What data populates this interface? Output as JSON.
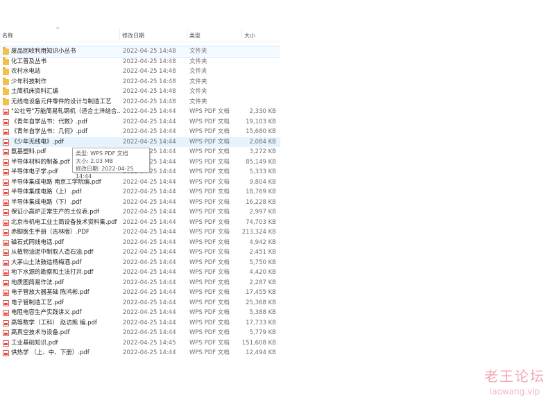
{
  "header": {
    "name": "名称",
    "date": "修改日期",
    "type": "类型",
    "size": "大小",
    "sort_arrow": "^"
  },
  "rows": [
    {
      "name": "废品回收利用知识小丛书",
      "date": "2022-04-25 14:48",
      "type": "文件夹",
      "size": "",
      "kind": "folder"
    },
    {
      "name": "化工普及丛书",
      "date": "2022-04-25 14:48",
      "type": "文件夹",
      "size": "",
      "kind": "folder"
    },
    {
      "name": "农村水电站",
      "date": "2022-04-25 14:48",
      "type": "文件夹",
      "size": "",
      "kind": "folder"
    },
    {
      "name": "少年科技制作",
      "date": "2022-04-25 14:48",
      "type": "文件夹",
      "size": "",
      "kind": "folder"
    },
    {
      "name": "土简机床资料汇编",
      "date": "2022-04-25 14:48",
      "type": "文件夹",
      "size": "",
      "kind": "folder"
    },
    {
      "name": "无线电设备元件零件的设计与制造工艺",
      "date": "2022-04-25 14:48",
      "type": "文件夹",
      "size": "",
      "kind": "folder"
    },
    {
      "name": "\"公社号\"万能简易轧钢机（适合土洋结合...",
      "date": "2022-04-25 14:44",
      "type": "WPS PDF 文档",
      "size": "2,330 KB",
      "kind": "pdf"
    },
    {
      "name": "《青年自学丛书：代数》.pdf",
      "date": "2022-04-25 14:44",
      "type": "WPS PDF 文档",
      "size": "19,103 KB",
      "kind": "pdf"
    },
    {
      "name": "《青年自学丛书：几何》.pdf",
      "date": "2022-04-25 14:44",
      "type": "WPS PDF 文档",
      "size": "15,680 KB",
      "kind": "pdf"
    },
    {
      "name": "《少年无线电》.pdf",
      "date": "2022-04-25 14:44",
      "type": "WPS PDF 文档",
      "size": "2,084 KB",
      "kind": "pdf"
    },
    {
      "name": "氨基塑料.pdf",
      "date": "2022-04-25 14:44",
      "type": "WPS PDF 文档",
      "size": "3,272 KB",
      "kind": "pdf"
    },
    {
      "name": "半导体材料的制备.pdf",
      "date": "2022-04-25 14:44",
      "type": "WPS PDF 文档",
      "size": "85,149 KB",
      "kind": "pdf"
    },
    {
      "name": "半导体电子学.pdf",
      "date": "2022-04-25 14:44",
      "type": "WPS PDF 文档",
      "size": "5,333 KB",
      "kind": "pdf"
    },
    {
      "name": "半导体集成电路 南京工学院编.pdf",
      "date": "2022-04-25 14:44",
      "type": "WPS PDF 文档",
      "size": "9,804 KB",
      "kind": "pdf"
    },
    {
      "name": "半导体集成电路（上）.pdf",
      "date": "2022-04-25 14:44",
      "type": "WPS PDF 文档",
      "size": "18,769 KB",
      "kind": "pdf"
    },
    {
      "name": "半导体集成电路（下）.pdf",
      "date": "2022-04-25 14:44",
      "type": "WPS PDF 文档",
      "size": "16,228 KB",
      "kind": "pdf"
    },
    {
      "name": "保证小高炉正常生产的土仪表.pdf",
      "date": "2022-04-25 14:44",
      "type": "WPS PDF 文档",
      "size": "2,997 KB",
      "kind": "pdf"
    },
    {
      "name": "北京市机电工业土简设备技术资料集.pdf",
      "date": "2022-04-25 14:44",
      "type": "WPS PDF 文档",
      "size": "74,703 KB",
      "kind": "pdf"
    },
    {
      "name": "赤脚医生手册（吉林版）.PDF",
      "date": "2022-04-25 14:44",
      "type": "WPS PDF 文档",
      "size": "213,324 KB",
      "kind": "pdf"
    },
    {
      "name": "磁石式同线电话.pdf",
      "date": "2022-04-25 14:44",
      "type": "WPS PDF 文档",
      "size": "4,942 KB",
      "kind": "pdf"
    },
    {
      "name": "从植物油泥中制取人造石油.pdf",
      "date": "2022-04-25 14:44",
      "type": "WPS PDF 文档",
      "size": "2,451 KB",
      "kind": "pdf"
    },
    {
      "name": "大茅山土法鼓造杨梅酒.pdf",
      "date": "2022-04-25 14:44",
      "type": "WPS PDF 文档",
      "size": "5,750 KB",
      "kind": "pdf"
    },
    {
      "name": "地下水源的勘察和土法打井.pdf",
      "date": "2022-04-25 14:44",
      "type": "WPS PDF 文档",
      "size": "4,420 KB",
      "kind": "pdf"
    },
    {
      "name": "地质图简易作法.pdf",
      "date": "2022-04-25 14:44",
      "type": "WPS PDF 文档",
      "size": "2,287 KB",
      "kind": "pdf"
    },
    {
      "name": "电子管放大器基础 陈鸿彬.pdf",
      "date": "2022-04-25 14:44",
      "type": "WPS PDF 文档",
      "size": "17,455 KB",
      "kind": "pdf"
    },
    {
      "name": "电子管制造工艺.pdf",
      "date": "2022-04-25 14:44",
      "type": "WPS PDF 文档",
      "size": "25,368 KB",
      "kind": "pdf"
    },
    {
      "name": "电阻电容生产实践讲义.pdf",
      "date": "2022-04-25 14:44",
      "type": "WPS PDF 文档",
      "size": "5,388 KB",
      "kind": "pdf"
    },
    {
      "name": "高等数学（工科） 赵访熊 编.pdf",
      "date": "2022-04-25 14:44",
      "type": "WPS PDF 文档",
      "size": "17,733 KB",
      "kind": "pdf"
    },
    {
      "name": "高真空技术与设备.pdf",
      "date": "2022-04-25 14:44",
      "type": "WPS PDF 文档",
      "size": "5,779 KB",
      "kind": "pdf"
    },
    {
      "name": "工业基础知识.pdf",
      "date": "2022-04-25 14:45",
      "type": "WPS PDF 文档",
      "size": "151,608 KB",
      "kind": "pdf"
    },
    {
      "name": "供热学 （上、中、下册）.pdf",
      "date": "2022-04-25 14:44",
      "type": "WPS PDF 文档",
      "size": "12,494 KB",
      "kind": "pdf"
    }
  ],
  "tooltip": {
    "type_line": "类型: WPS PDF 文档",
    "size_line": "大小: 2.03 MB",
    "date_line": "修改日期: 2022-04-25 14:44"
  },
  "watermark": {
    "cn": "老王论坛",
    "en": "laowang.vip"
  }
}
